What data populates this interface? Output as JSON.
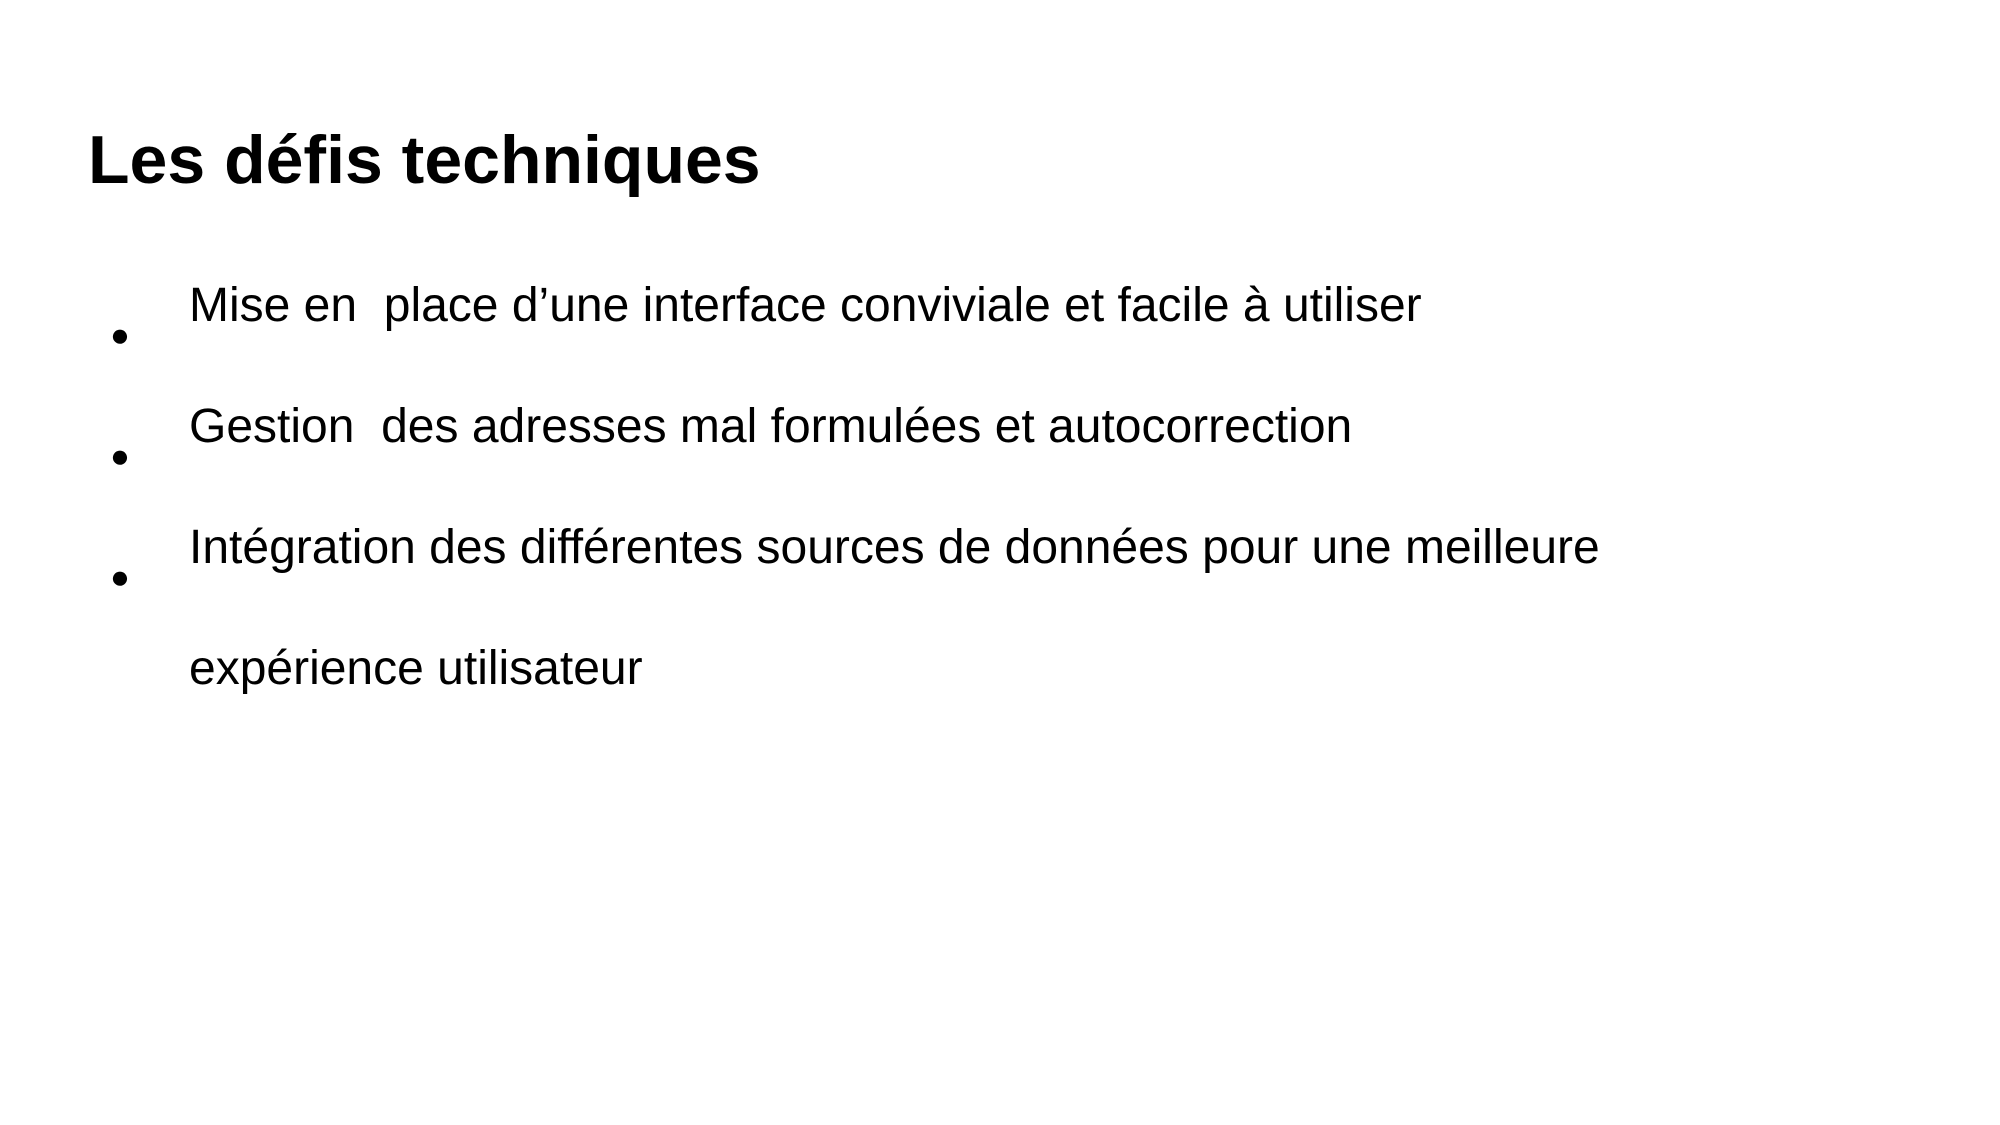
{
  "slide": {
    "title": "Les défis techniques",
    "bullet_symbol": "●",
    "bullets": [
      {
        "text": "Mise en  place d’une interface conviviale et facile à utiliser"
      },
      {
        "text": "Gestion  des adresses mal formulées et autocorrection"
      },
      {
        "text": "Intégration des différentes sources de données pour une meilleure expérience utilisateur"
      }
    ]
  }
}
